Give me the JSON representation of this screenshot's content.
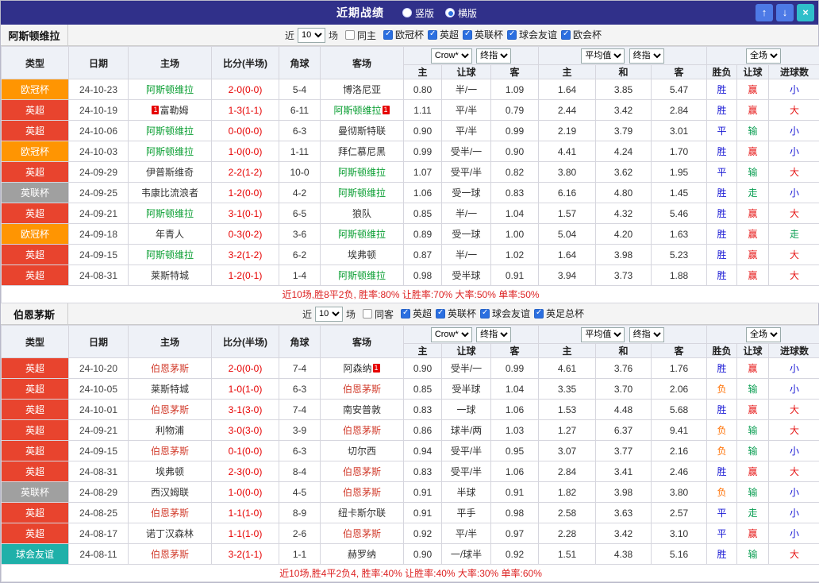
{
  "titlebar": {
    "title": "近期战绩",
    "radios": [
      {
        "label": "竖版",
        "selected": false
      },
      {
        "label": "横版",
        "selected": true
      }
    ],
    "buttons": {
      "up": "↑",
      "down": "↓",
      "close": "×"
    }
  },
  "filters": {
    "recent_label": "近",
    "count": "10",
    "matches_label": "场"
  },
  "table": {
    "columns": [
      "类型",
      "日期",
      "主场",
      "比分(半场)",
      "角球",
      "客场",
      "主",
      "让球",
      "客",
      "主",
      "和",
      "客",
      "胜负",
      "让球",
      "进球数"
    ],
    "selects": {
      "bookmaker": "Crow*",
      "final_a": "终指",
      "average": "平均值",
      "final_b": "终指",
      "scope": "全场"
    }
  },
  "league_colors": {
    "欧冠杯": "#ff9502",
    "英超": "#e8442e",
    "英联杯": "#a0a0a0",
    "球会友谊": "#1fb0a9"
  },
  "result_colors": {
    "胜": "#1717d4",
    "平": "#1717d4",
    "负": "#ff6f00",
    "赢": "#e61717",
    "输": "#0a9e52",
    "走": "#0a9e52",
    "大": "#e61717",
    "小": "#1717d4"
  },
  "sections": [
    {
      "team": "阿斯顿维拉",
      "team_color": "#0a9e32",
      "same_label": "同主",
      "same_checked": false,
      "leagues": [
        "欧冠杯",
        "英超",
        "英联杯",
        "球会友谊",
        "欧会杯"
      ],
      "rows": [
        {
          "type": "欧冠杯",
          "date": "24-10-23",
          "home": "阿斯顿维拉",
          "home_focus": true,
          "home_card": "",
          "score": "2-0(0-0)",
          "corner": "5-4",
          "away": "博洛尼亚",
          "away_focus": false,
          "away_card": "",
          "ah": [
            "0.80",
            "半/一",
            "1.09"
          ],
          "eu": [
            "1.64",
            "3.85",
            "5.47"
          ],
          "res": [
            "胜",
            "赢",
            "小"
          ]
        },
        {
          "type": "英超",
          "date": "24-10-19",
          "home": "富勒姆",
          "home_focus": false,
          "home_card": "1",
          "score": "1-3(1-1)",
          "corner": "6-11",
          "away": "阿斯顿维拉",
          "away_focus": true,
          "away_card": "1",
          "ah": [
            "1.11",
            "平/半",
            "0.79"
          ],
          "eu": [
            "2.44",
            "3.42",
            "2.84"
          ],
          "res": [
            "胜",
            "赢",
            "大"
          ]
        },
        {
          "type": "英超",
          "date": "24-10-06",
          "home": "阿斯顿维拉",
          "home_focus": true,
          "home_card": "",
          "score": "0-0(0-0)",
          "corner": "6-3",
          "away": "曼彻斯特联",
          "away_focus": false,
          "away_card": "",
          "ah": [
            "0.90",
            "平/半",
            "0.99"
          ],
          "eu": [
            "2.19",
            "3.79",
            "3.01"
          ],
          "res": [
            "平",
            "输",
            "小"
          ]
        },
        {
          "type": "欧冠杯",
          "date": "24-10-03",
          "home": "阿斯顿维拉",
          "home_focus": true,
          "home_card": "",
          "score": "1-0(0-0)",
          "corner": "1-11",
          "away": "拜仁慕尼黑",
          "away_focus": false,
          "away_card": "",
          "ah": [
            "0.99",
            "受半/一",
            "0.90"
          ],
          "eu": [
            "4.41",
            "4.24",
            "1.70"
          ],
          "res": [
            "胜",
            "赢",
            "小"
          ]
        },
        {
          "type": "英超",
          "date": "24-09-29",
          "home": "伊普斯维奇",
          "home_focus": false,
          "home_card": "",
          "score": "2-2(1-2)",
          "corner": "10-0",
          "away": "阿斯顿维拉",
          "away_focus": true,
          "away_card": "",
          "ah": [
            "1.07",
            "受平/半",
            "0.82"
          ],
          "eu": [
            "3.80",
            "3.62",
            "1.95"
          ],
          "res": [
            "平",
            "输",
            "大"
          ]
        },
        {
          "type": "英联杯",
          "date": "24-09-25",
          "home": "韦康比流浪者",
          "home_focus": false,
          "home_card": "",
          "score": "1-2(0-0)",
          "corner": "4-2",
          "away": "阿斯顿维拉",
          "away_focus": true,
          "away_card": "",
          "ah": [
            "1.06",
            "受一球",
            "0.83"
          ],
          "eu": [
            "6.16",
            "4.80",
            "1.45"
          ],
          "res": [
            "胜",
            "走",
            "小"
          ]
        },
        {
          "type": "英超",
          "date": "24-09-21",
          "home": "阿斯顿维拉",
          "home_focus": true,
          "home_card": "",
          "score": "3-1(0-1)",
          "corner": "6-5",
          "away": "狼队",
          "away_focus": false,
          "away_card": "",
          "ah": [
            "0.85",
            "半/一",
            "1.04"
          ],
          "eu": [
            "1.57",
            "4.32",
            "5.46"
          ],
          "res": [
            "胜",
            "赢",
            "大"
          ]
        },
        {
          "type": "欧冠杯",
          "date": "24-09-18",
          "home": "年青人",
          "home_focus": false,
          "home_card": "",
          "score": "0-3(0-2)",
          "corner": "3-6",
          "away": "阿斯顿维拉",
          "away_focus": true,
          "away_card": "",
          "ah": [
            "0.89",
            "受一球",
            "1.00"
          ],
          "eu": [
            "5.04",
            "4.20",
            "1.63"
          ],
          "res": [
            "胜",
            "赢",
            "走"
          ]
        },
        {
          "type": "英超",
          "date": "24-09-15",
          "home": "阿斯顿维拉",
          "home_focus": true,
          "home_card": "",
          "score": "3-2(1-2)",
          "corner": "6-2",
          "away": "埃弗顿",
          "away_focus": false,
          "away_card": "",
          "ah": [
            "0.87",
            "半/一",
            "1.02"
          ],
          "eu": [
            "1.64",
            "3.98",
            "5.23"
          ],
          "res": [
            "胜",
            "赢",
            "大"
          ]
        },
        {
          "type": "英超",
          "date": "24-08-31",
          "home": "莱斯特城",
          "home_focus": false,
          "home_card": "",
          "score": "1-2(0-1)",
          "corner": "1-4",
          "away": "阿斯顿维拉",
          "away_focus": true,
          "away_card": "",
          "ah": [
            "0.98",
            "受半球",
            "0.91"
          ],
          "eu": [
            "3.94",
            "3.73",
            "1.88"
          ],
          "res": [
            "胜",
            "赢",
            "大"
          ]
        }
      ],
      "summary": "近10场,胜8平2负, 胜率:80% 让胜率:70% 大率:50% 单率:50%"
    },
    {
      "team": "伯恩茅斯",
      "team_color": "#d23e2e",
      "same_label": "同客",
      "same_checked": false,
      "leagues": [
        "英超",
        "英联杯",
        "球会友谊",
        "英足总杯"
      ],
      "rows": [
        {
          "type": "英超",
          "date": "24-10-20",
          "home": "伯恩茅斯",
          "home_focus": true,
          "home_card": "",
          "score": "2-0(0-0)",
          "corner": "7-4",
          "away": "阿森纳",
          "away_focus": false,
          "away_card": "1",
          "ah": [
            "0.90",
            "受半/一",
            "0.99"
          ],
          "eu": [
            "4.61",
            "3.76",
            "1.76"
          ],
          "res": [
            "胜",
            "赢",
            "小"
          ]
        },
        {
          "type": "英超",
          "date": "24-10-05",
          "home": "莱斯特城",
          "home_focus": false,
          "home_card": "",
          "score": "1-0(1-0)",
          "corner": "6-3",
          "away": "伯恩茅斯",
          "away_focus": true,
          "away_card": "",
          "ah": [
            "0.85",
            "受半球",
            "1.04"
          ],
          "eu": [
            "3.35",
            "3.70",
            "2.06"
          ],
          "res": [
            "负",
            "输",
            "小"
          ]
        },
        {
          "type": "英超",
          "date": "24-10-01",
          "home": "伯恩茅斯",
          "home_focus": true,
          "home_card": "",
          "score": "3-1(3-0)",
          "corner": "7-4",
          "away": "南安普敦",
          "away_focus": false,
          "away_card": "",
          "ah": [
            "0.83",
            "一球",
            "1.06"
          ],
          "eu": [
            "1.53",
            "4.48",
            "5.68"
          ],
          "res": [
            "胜",
            "赢",
            "大"
          ]
        },
        {
          "type": "英超",
          "date": "24-09-21",
          "home": "利物浦",
          "home_focus": false,
          "home_card": "",
          "score": "3-0(3-0)",
          "corner": "3-9",
          "away": "伯恩茅斯",
          "away_focus": true,
          "away_card": "",
          "ah": [
            "0.86",
            "球半/两",
            "1.03"
          ],
          "eu": [
            "1.27",
            "6.37",
            "9.41"
          ],
          "res": [
            "负",
            "输",
            "大"
          ]
        },
        {
          "type": "英超",
          "date": "24-09-15",
          "home": "伯恩茅斯",
          "home_focus": true,
          "home_card": "",
          "score": "0-1(0-0)",
          "corner": "6-3",
          "away": "切尔西",
          "away_focus": false,
          "away_card": "",
          "ah": [
            "0.94",
            "受平/半",
            "0.95"
          ],
          "eu": [
            "3.07",
            "3.77",
            "2.16"
          ],
          "res": [
            "负",
            "输",
            "小"
          ]
        },
        {
          "type": "英超",
          "date": "24-08-31",
          "home": "埃弗顿",
          "home_focus": false,
          "home_card": "",
          "score": "2-3(0-0)",
          "corner": "8-4",
          "away": "伯恩茅斯",
          "away_focus": true,
          "away_card": "",
          "ah": [
            "0.83",
            "受平/半",
            "1.06"
          ],
          "eu": [
            "2.84",
            "3.41",
            "2.46"
          ],
          "res": [
            "胜",
            "赢",
            "大"
          ]
        },
        {
          "type": "英联杯",
          "date": "24-08-29",
          "home": "西汉姆联",
          "home_focus": false,
          "home_card": "",
          "score": "1-0(0-0)",
          "corner": "4-5",
          "away": "伯恩茅斯",
          "away_focus": true,
          "away_card": "",
          "ah": [
            "0.91",
            "半球",
            "0.91"
          ],
          "eu": [
            "1.82",
            "3.98",
            "3.80"
          ],
          "res": [
            "负",
            "输",
            "小"
          ]
        },
        {
          "type": "英超",
          "date": "24-08-25",
          "home": "伯恩茅斯",
          "home_focus": true,
          "home_card": "",
          "score": "1-1(1-0)",
          "corner": "8-9",
          "away": "纽卡斯尔联",
          "away_focus": false,
          "away_card": "",
          "ah": [
            "0.91",
            "平手",
            "0.98"
          ],
          "eu": [
            "2.58",
            "3.63",
            "2.57"
          ],
          "res": [
            "平",
            "走",
            "小"
          ]
        },
        {
          "type": "英超",
          "date": "24-08-17",
          "home": "诺丁汉森林",
          "home_focus": false,
          "home_card": "",
          "score": "1-1(1-0)",
          "corner": "2-6",
          "away": "伯恩茅斯",
          "away_focus": true,
          "away_card": "",
          "ah": [
            "0.92",
            "平/半",
            "0.97"
          ],
          "eu": [
            "2.28",
            "3.42",
            "3.10"
          ],
          "res": [
            "平",
            "赢",
            "小"
          ]
        },
        {
          "type": "球会友谊",
          "date": "24-08-11",
          "home": "伯恩茅斯",
          "home_focus": true,
          "home_card": "",
          "score": "3-2(1-1)",
          "corner": "1-1",
          "away": "赫罗纳",
          "away_focus": false,
          "away_card": "",
          "ah": [
            "0.90",
            "一/球半",
            "0.92"
          ],
          "eu": [
            "1.51",
            "4.38",
            "5.16"
          ],
          "res": [
            "胜",
            "输",
            "大"
          ]
        }
      ],
      "summary": "近10场,胜4平2负4, 胜率:40% 让胜率:40% 大率:30% 单率:60%"
    }
  ]
}
